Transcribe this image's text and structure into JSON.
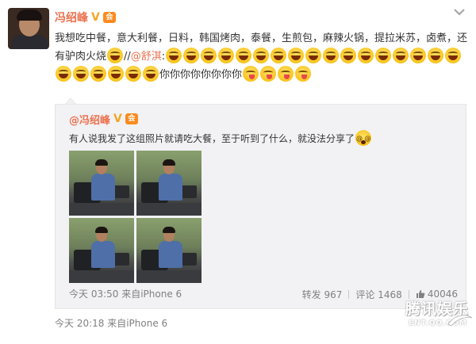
{
  "post": {
    "author": "冯绍峰",
    "verified_badge": "V",
    "vip_badge": "会",
    "text_part1": "我想吃中餐，意大利餐，日料，韩国烤肉，泰餐，生煎包，麻辣火锅，提拉米苏，卤煮，还有驴肉火烧",
    "mention_prefix": "//",
    "mention": "@舒淇",
    "mention_suffix": ":",
    "repeated_text": "你你你你你你你你",
    "time_source": "今天 20:18 来自iPhone 6"
  },
  "quoted": {
    "author": "@冯绍峰",
    "verified_badge": "V",
    "vip_badge": "会",
    "text": "有人说我发了这组照片就请吃大餐，至于听到了什么，就没法分享了",
    "images": [
      "photo-1",
      "photo-2",
      "photo-3",
      "photo-4"
    ],
    "time_source": "今天 03:50 来自iPhone 6",
    "repost_label": "转发",
    "repost_count": "967",
    "comment_label": "评论",
    "comment_count": "1468",
    "like_count": "40046"
  },
  "watermark": {
    "title": "腾讯娱乐",
    "subtitle": "ENT.QQ.COM"
  },
  "icons": {
    "more": "chevron-down-icon",
    "like": "thumb-up-icon",
    "emoji_laugh": "laugh-emoji-icon",
    "emoji_tongue": "tongue-emoji-icon",
    "emoji_dizzy": "dizzy-emoji-icon"
  },
  "colors": {
    "name_orange": "#eb7350",
    "quote_bg": "#f2f2f5",
    "meta_gray": "#808080"
  }
}
